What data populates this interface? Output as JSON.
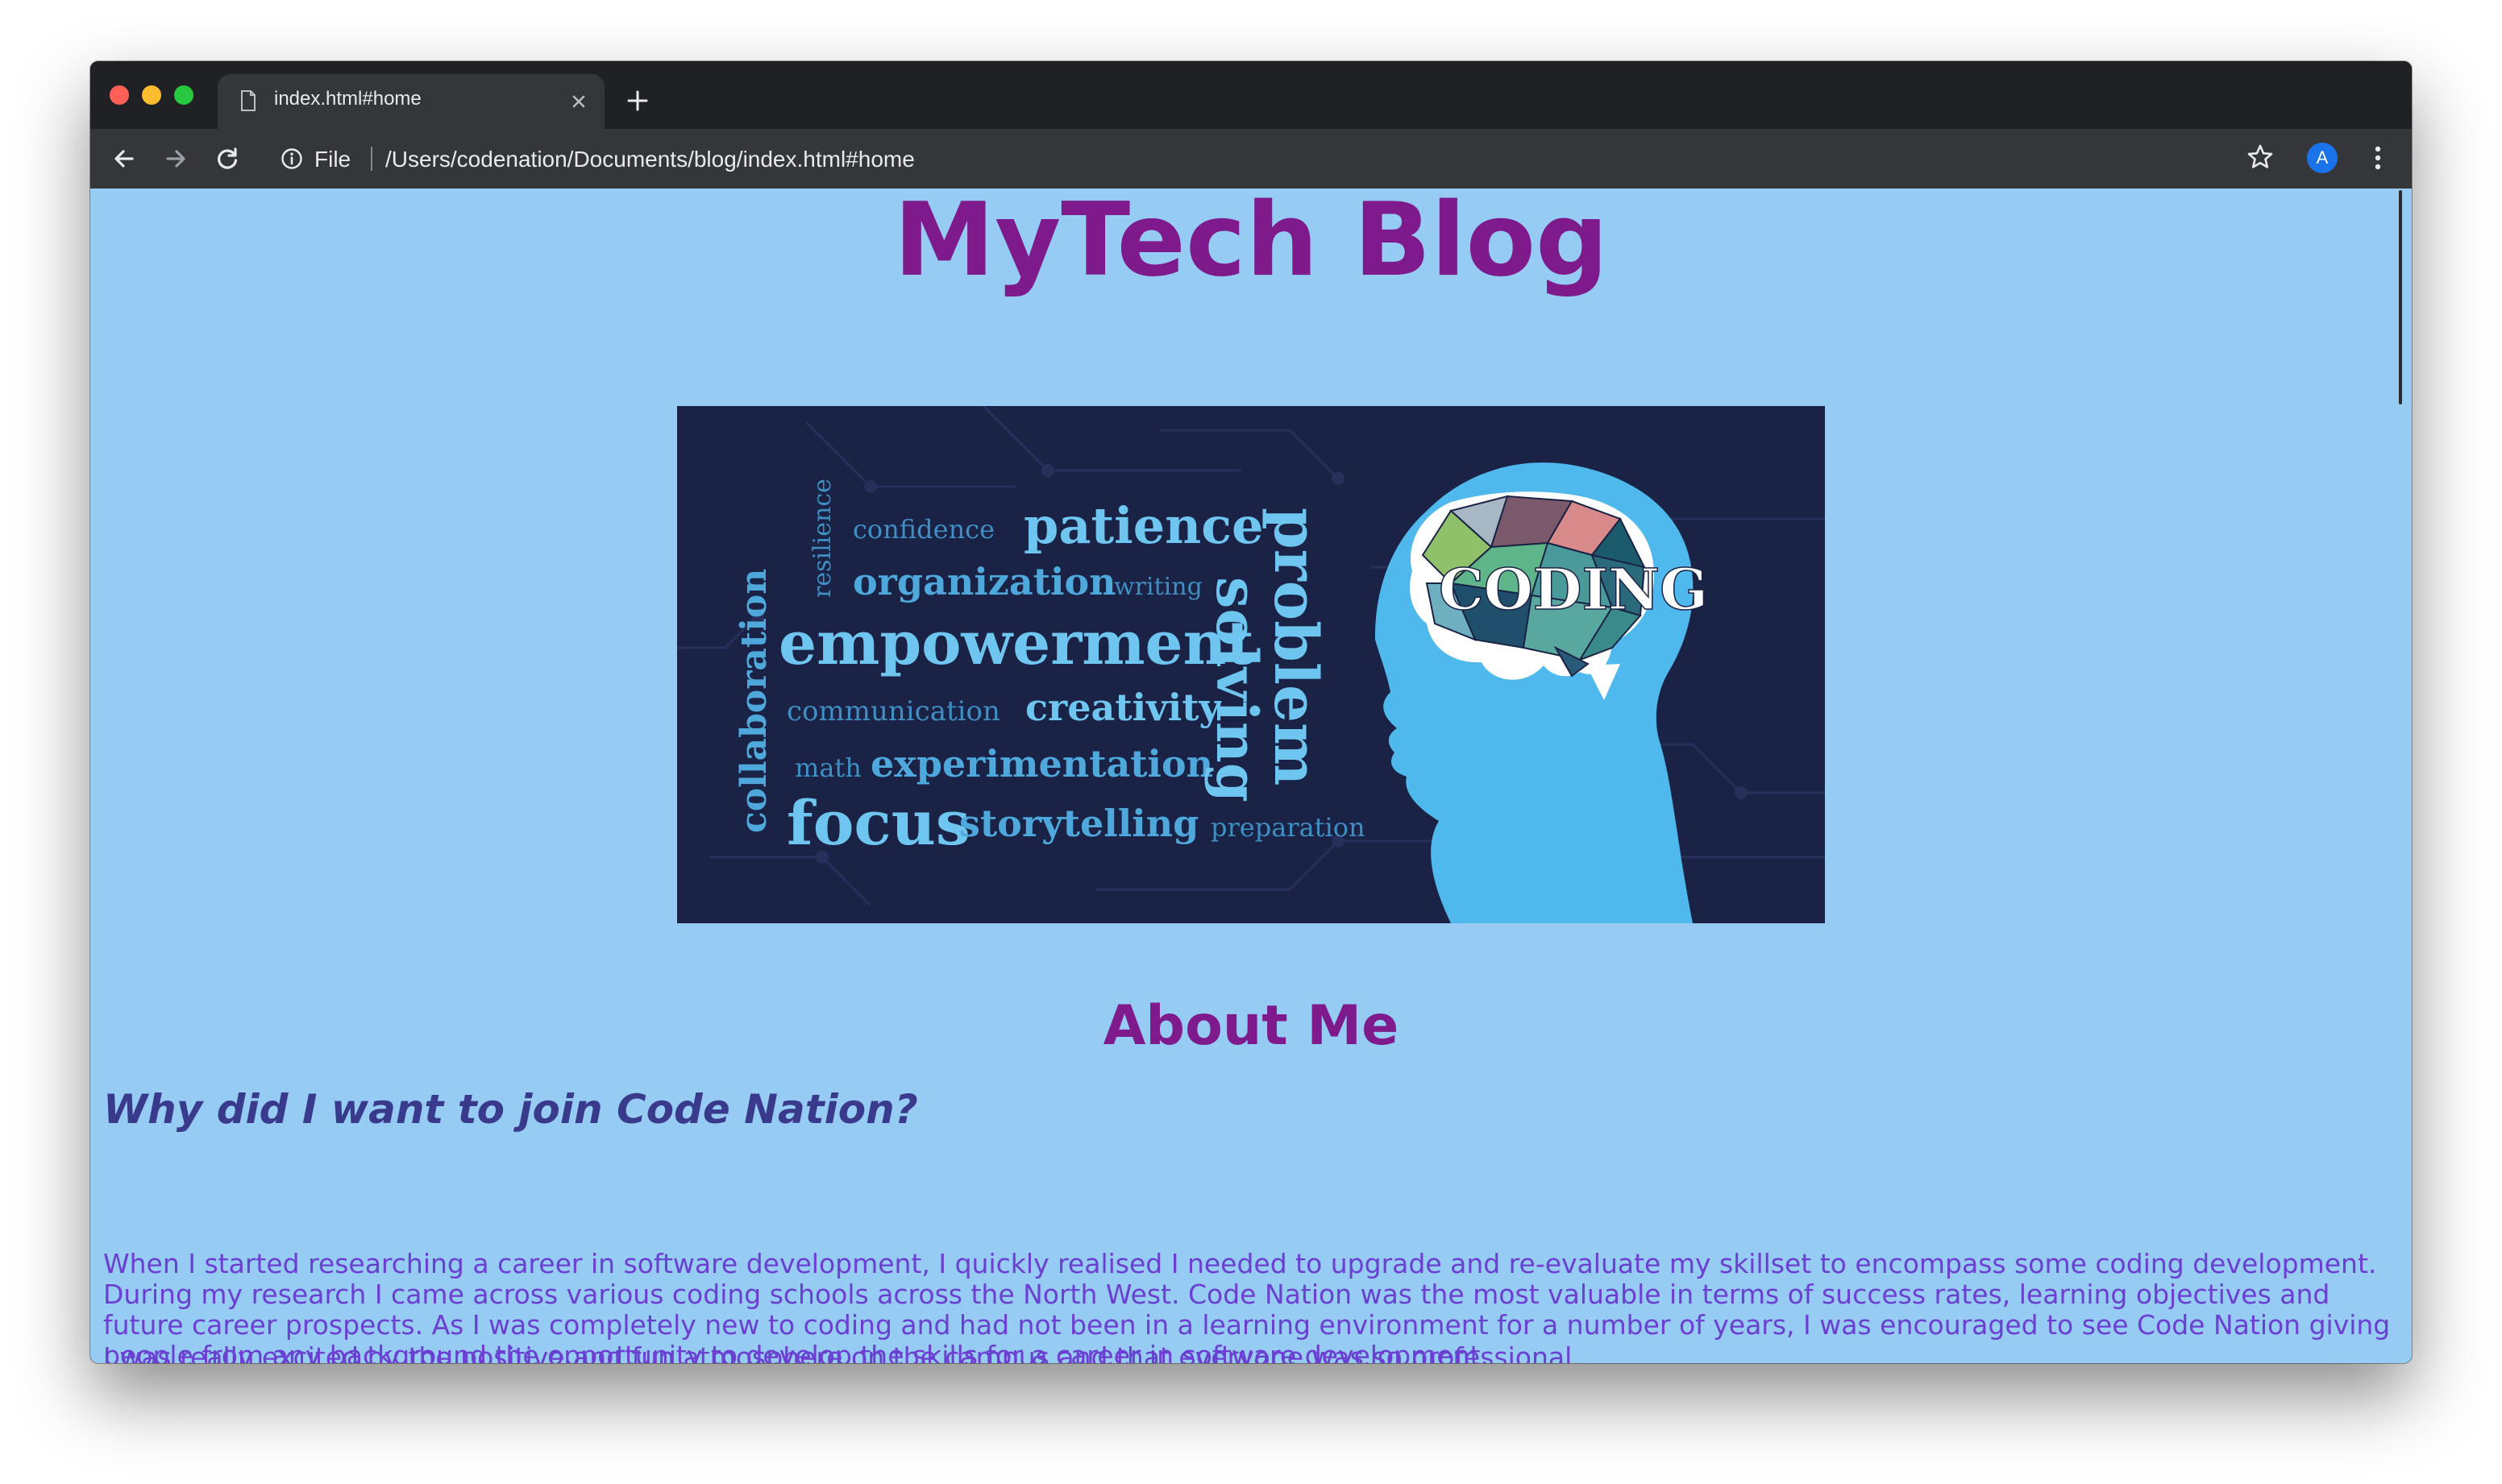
{
  "browser": {
    "tab_title": "index.html#home",
    "omnibox_scheme": "File",
    "url": "/Users/codenation/Documents/blog/index.html#home",
    "profile_initial": "A"
  },
  "page": {
    "site_title": "MyTech Blog",
    "hero": {
      "brain_label": "CODING",
      "words": [
        "resilience",
        "confidence",
        "patience",
        "organization",
        "writing",
        "empowerment",
        "communication",
        "creativity",
        "math",
        "experimentation",
        "focus",
        "storytelling",
        "preparation",
        "collaboration",
        "solving",
        "problem"
      ]
    },
    "about_heading": "About Me",
    "why_heading": "Why did I want to join Code Nation?",
    "paragraph_1": "When I started researching a career in software development, I quickly realised I needed to upgrade and re-evaluate my skillset to encompass some coding development. During my research I came across various coding schools across the North West. Code Nation was the most valuable in terms of success rates, learning objectives and future career prospects. As I was completely new to coding and had not been in a learning environment for a number of years, I was encouraged to see Code Nation giving people from any background the opportunity to develop the skills for a career in software development.",
    "paragraph_2": "I was really excited by the positive and fun atmosphere on the campus and that everyone was so professional."
  },
  "colors": {
    "page_background": "#96cbf4",
    "title_purple": "#7e1a8c",
    "heading_indigo": "#3a3a8c",
    "text_violet": "#6a3fd1",
    "hero_navy": "#1a2245",
    "hero_blue": "#4fb8ec"
  },
  "icons": [
    "document-icon",
    "close-icon",
    "plus-icon",
    "back-arrow-icon",
    "forward-arrow-icon",
    "reload-icon",
    "info-icon",
    "star-icon",
    "kebab-menu-icon"
  ]
}
